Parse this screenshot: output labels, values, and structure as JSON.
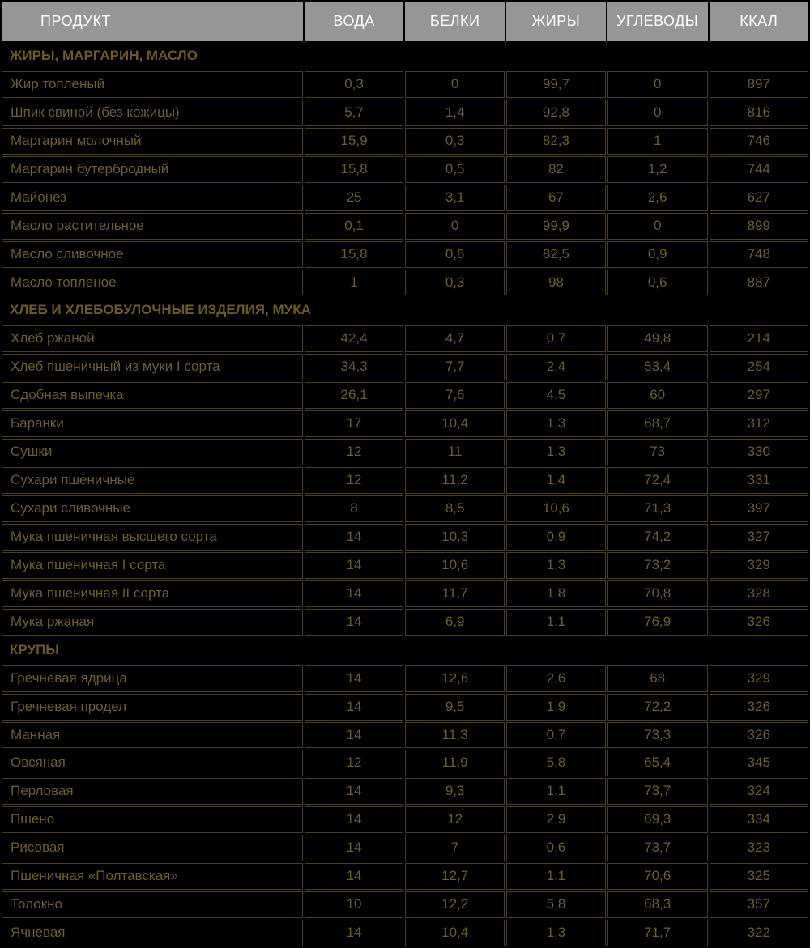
{
  "columns": [
    "ПРОДУКТ",
    "ВОДА",
    "БЕЛКИ",
    "ЖИРЫ",
    "УГЛЕВОДЫ",
    "ККАЛ"
  ],
  "sections": [
    {
      "title": "ЖИРЫ, МАРГАРИН, МАСЛО",
      "rows": [
        {
          "name": "Жир топленый",
          "water": "0,3",
          "protein": "0",
          "fat": "99,7",
          "carbs": "0",
          "kcal": "897"
        },
        {
          "name": "Шпик свиной (без кожицы)",
          "water": "5,7",
          "protein": "1,4",
          "fat": "92,8",
          "carbs": "0",
          "kcal": "816"
        },
        {
          "name": "Маргарин молочный",
          "water": "15,9",
          "protein": "0,3",
          "fat": "82,3",
          "carbs": "1",
          "kcal": "746"
        },
        {
          "name": "Маргарин бутербродный",
          "water": "15,8",
          "protein": "0,5",
          "fat": "82",
          "carbs": "1,2",
          "kcal": "744"
        },
        {
          "name": "Майонез",
          "water": "25",
          "protein": "3,1",
          "fat": "67",
          "carbs": "2,6",
          "kcal": "627"
        },
        {
          "name": "Масло растительное",
          "water": "0,1",
          "protein": "0",
          "fat": "99,9",
          "carbs": "0",
          "kcal": "899"
        },
        {
          "name": "Масло сливочное",
          "water": "15,8",
          "protein": "0,6",
          "fat": "82,5",
          "carbs": "0,9",
          "kcal": "748"
        },
        {
          "name": "Масло топленое",
          "water": "1",
          "protein": "0,3",
          "fat": "98",
          "carbs": "0,6",
          "kcal": "887"
        }
      ]
    },
    {
      "title": "ХЛЕБ И ХЛЕБОБУЛОЧНЫЕ ИЗДЕЛИЯ, МУКА",
      "rows": [
        {
          "name": "Хлеб ржаной",
          "water": "42,4",
          "protein": "4,7",
          "fat": "0,7",
          "carbs": "49,8",
          "kcal": "214"
        },
        {
          "name": "Хлеб пшеничный из муки I сорта",
          "water": "34,3",
          "protein": "7,7",
          "fat": "2,4",
          "carbs": "53,4",
          "kcal": "254"
        },
        {
          "name": "Сдобная выпечка",
          "water": "26,1",
          "protein": "7,6",
          "fat": "4,5",
          "carbs": "60",
          "kcal": "297"
        },
        {
          "name": "Баранки",
          "water": "17",
          "protein": "10,4",
          "fat": "1,3",
          "carbs": "68,7",
          "kcal": "312"
        },
        {
          "name": "Сушки",
          "water": "12",
          "protein": "11",
          "fat": "1,3",
          "carbs": "73",
          "kcal": "330"
        },
        {
          "name": "Сухари пшеничные",
          "water": "12",
          "protein": "11,2",
          "fat": "1,4",
          "carbs": "72,4",
          "kcal": "331"
        },
        {
          "name": "Сухари сливочные",
          "water": "8",
          "protein": "8,5",
          "fat": "10,6",
          "carbs": "71,3",
          "kcal": "397"
        },
        {
          "name": "Мука пшеничная высшего сорта",
          "water": "14",
          "protein": "10,3",
          "fat": "0,9",
          "carbs": "74,2",
          "kcal": "327"
        },
        {
          "name": "Мука пшеничная I сорта",
          "water": "14",
          "protein": "10,6",
          "fat": "1,3",
          "carbs": "73,2",
          "kcal": "329"
        },
        {
          "name": "Мука пшеничная II сорта",
          "water": "14",
          "protein": "11,7",
          "fat": "1,8",
          "carbs": "70,8",
          "kcal": "328"
        },
        {
          "name": "Мука ржаная",
          "water": "14",
          "protein": "6,9",
          "fat": "1,1",
          "carbs": "76,9",
          "kcal": "326"
        }
      ]
    },
    {
      "title": "КРУПЫ",
      "rows": [
        {
          "name": "Гречневая ядрица",
          "water": "14",
          "protein": "12,6",
          "fat": "2,6",
          "carbs": "68",
          "kcal": "329"
        },
        {
          "name": "Гречневая продел",
          "water": "14",
          "protein": "9,5",
          "fat": "1,9",
          "carbs": "72,2",
          "kcal": "326"
        },
        {
          "name": "Манная",
          "water": "14",
          "protein": "11,3",
          "fat": "0,7",
          "carbs": "73,3",
          "kcal": "326"
        },
        {
          "name": "Овсяная",
          "water": "12",
          "protein": "11,9",
          "fat": "5,8",
          "carbs": "65,4",
          "kcal": "345"
        },
        {
          "name": "Перловая",
          "water": "14",
          "protein": "9,3",
          "fat": "1,1",
          "carbs": "73,7",
          "kcal": "324"
        },
        {
          "name": "Пшено",
          "water": "14",
          "protein": "12",
          "fat": "2,9",
          "carbs": "69,3",
          "kcal": "334"
        },
        {
          "name": "Рисовая",
          "water": "14",
          "protein": "7",
          "fat": "0,6",
          "carbs": "73,7",
          "kcal": "323"
        },
        {
          "name": "Пшеничная «Полтавская»",
          "water": "14",
          "protein": "12,7",
          "fat": "1,1",
          "carbs": "70,6",
          "kcal": "325"
        },
        {
          "name": "Толокно",
          "water": "10",
          "protein": "12,2",
          "fat": "5,8",
          "carbs": "68,3",
          "kcal": "357"
        },
        {
          "name": "Ячневая",
          "water": "14",
          "protein": "10,4",
          "fat": "1,3",
          "carbs": "71,7",
          "kcal": "322"
        }
      ]
    }
  ]
}
